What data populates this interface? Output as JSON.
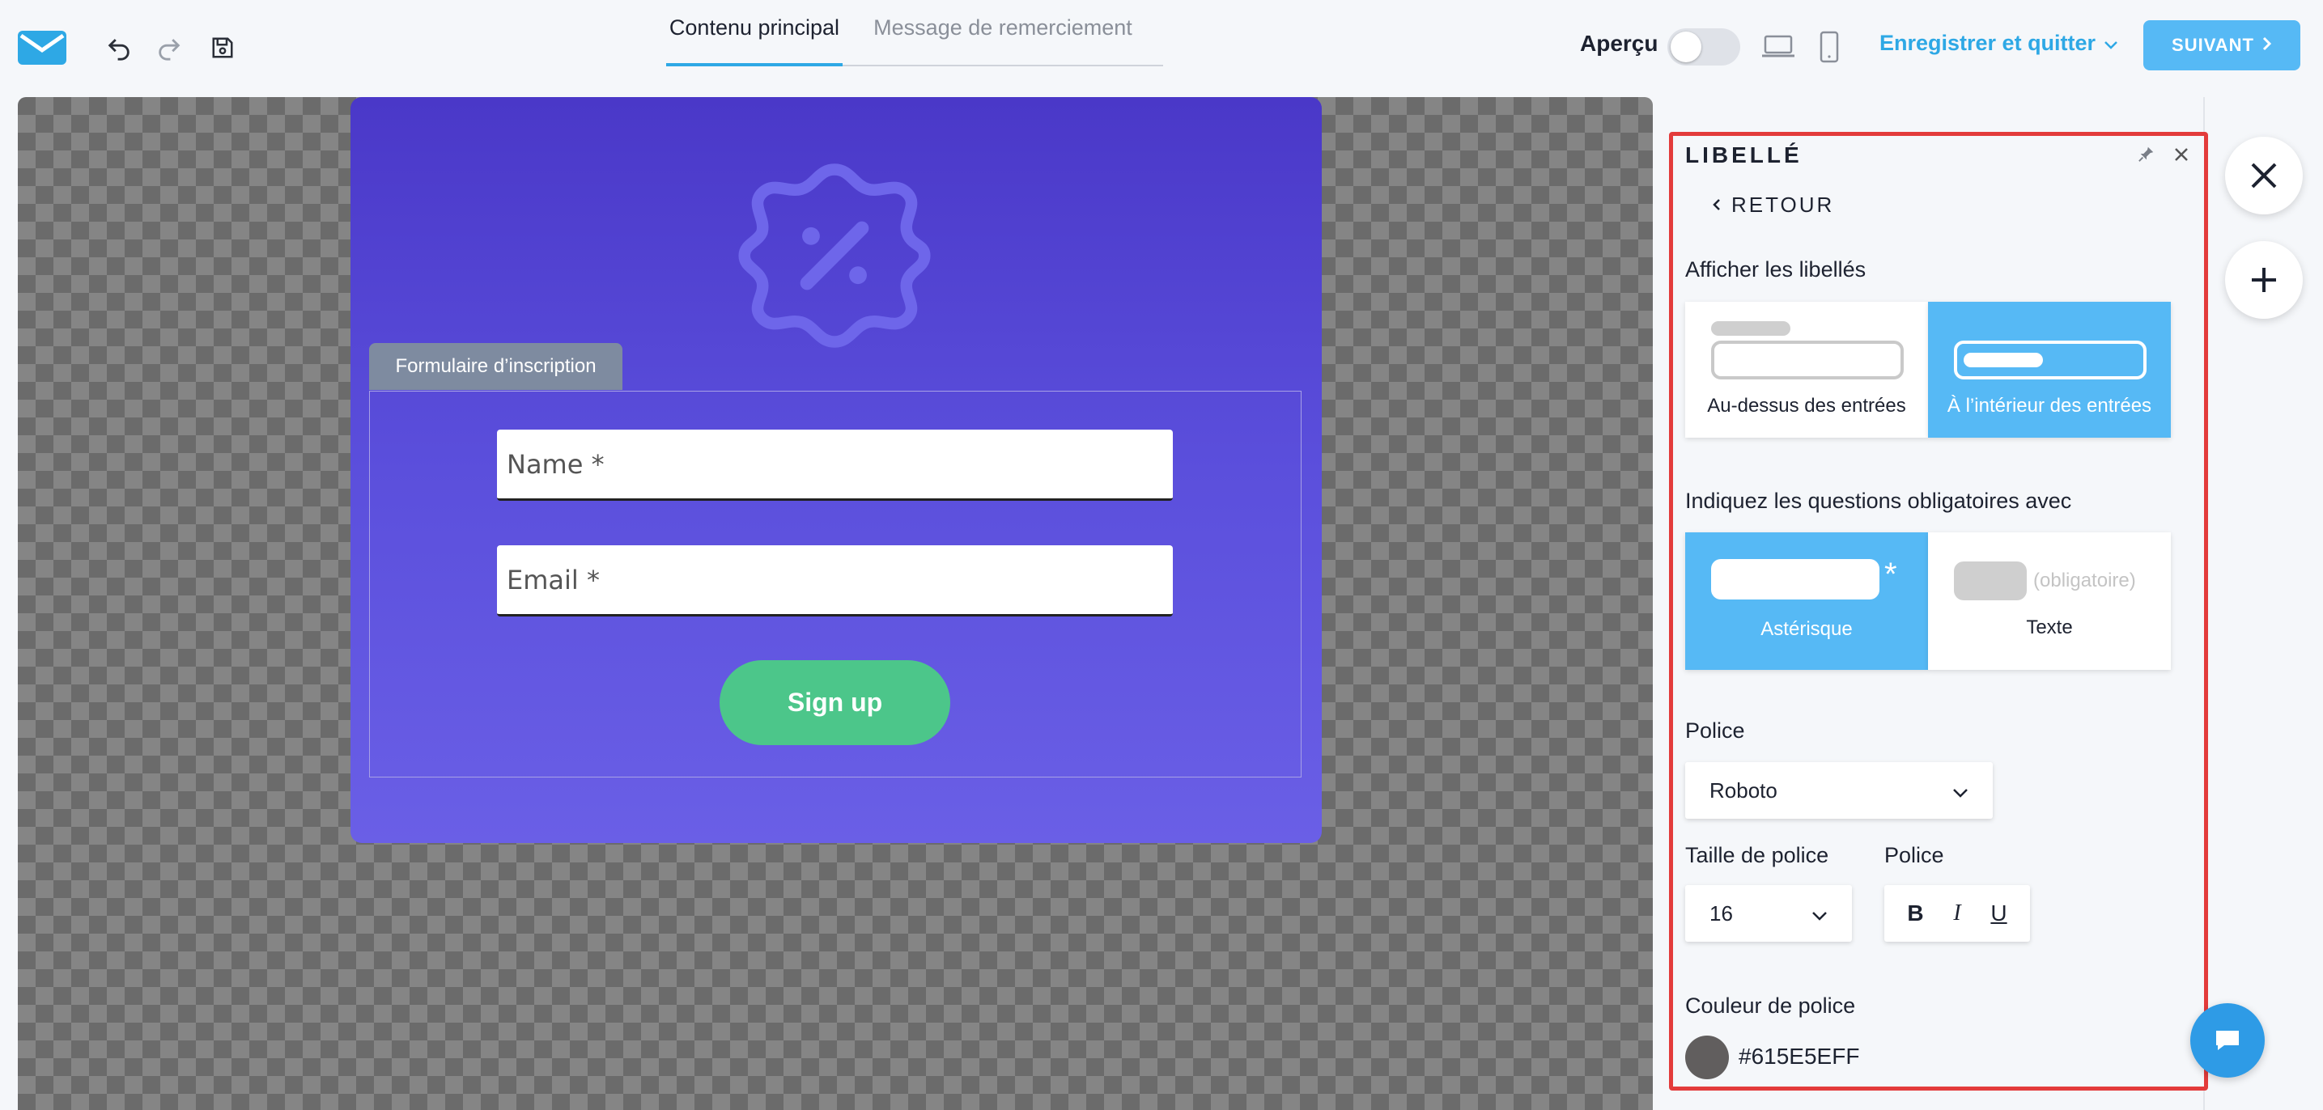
{
  "header": {
    "tabs": [
      "Contenu principal",
      "Message de remerciement"
    ],
    "preview_label": "Aperçu",
    "save_quit": "Enregistrer et quitter",
    "next_label": "SUIVANT"
  },
  "form": {
    "tab_label": "Formulaire d’inscription",
    "fields": [
      "Name *",
      "Email *"
    ],
    "button_label": "Sign up"
  },
  "panel": {
    "title": "LIBELLÉ",
    "back_label": "RETOUR",
    "show_labels_heading": "Afficher les libellés",
    "label_options": [
      "Au-dessus des entrées",
      "À l’intérieur des entrées"
    ],
    "required_heading": "Indiquez les questions obligatoires avec",
    "required_options": [
      "Astérisque",
      "Texte"
    ],
    "required_text_sample": "(obligatoire)",
    "font_heading": "Police",
    "font_value": "Roboto",
    "font_size_heading": "Taille de police",
    "font_size_value": "16",
    "font_style_heading": "Police",
    "format_buttons": [
      "B",
      "I",
      "U"
    ],
    "font_color_heading": "Couleur de police",
    "font_color_value": "#615E5EFF"
  },
  "colors": {
    "accent": "#2ea8e5",
    "selected": "#56b9f5",
    "card": "#5b4fdc",
    "button": "#4cc68a",
    "highlight": "#e33b3b",
    "swatch": "#615e5e"
  }
}
